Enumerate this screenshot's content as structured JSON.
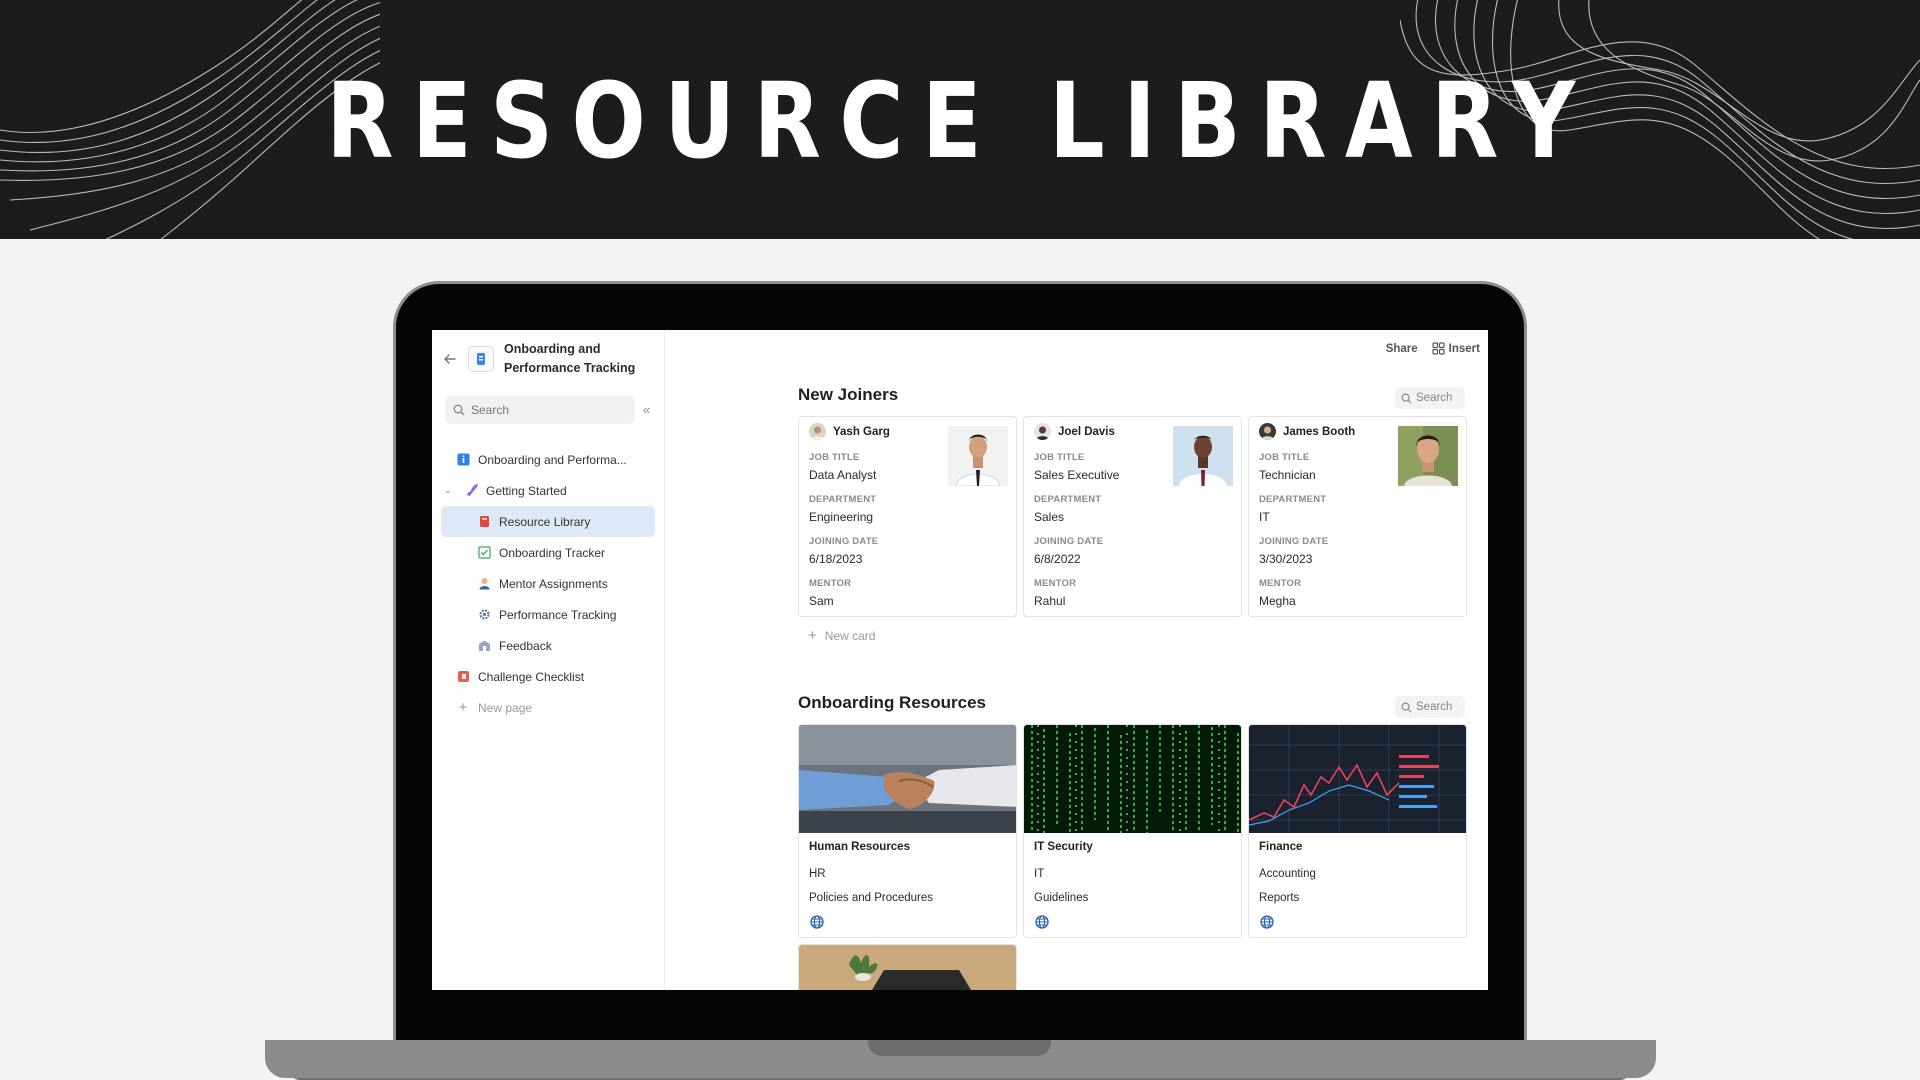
{
  "banner": {
    "title": "RESOURCE LIBRARY"
  },
  "sidebar": {
    "workspace_title": "Onboarding and Performance Tracking",
    "search_placeholder": "Search",
    "items": [
      {
        "label": "Onboarding and Performa...",
        "icon": "info-icon"
      },
      {
        "label": "Getting Started",
        "icon": "rocket-icon"
      },
      {
        "label": "Resource Library",
        "icon": "books-icon"
      },
      {
        "label": "Onboarding Tracker",
        "icon": "checkbox-icon"
      },
      {
        "label": "Mentor Assignments",
        "icon": "person-icon"
      },
      {
        "label": "Performance Tracking",
        "icon": "gear-icon"
      },
      {
        "label": "Feedback",
        "icon": "building-icon"
      },
      {
        "label": "Challenge Checklist",
        "icon": "flag-icon"
      }
    ],
    "new_page": "New page"
  },
  "topbar": {
    "share": "Share",
    "insert": "Insert"
  },
  "new_joiners": {
    "title": "New Joiners",
    "search": "Search",
    "field_labels": {
      "job_title": "JOB TITLE",
      "department": "DEPARTMENT",
      "joining_date": "JOINING DATE",
      "mentor": "MENTOR"
    },
    "cards": [
      {
        "name": "Yash Garg",
        "job_title": "Data Analyst",
        "department": "Engineering",
        "joining_date": "6/18/2023",
        "mentor": "Sam"
      },
      {
        "name": "Joel Davis",
        "job_title": "Sales Executive",
        "department": "Sales",
        "joining_date": "6/8/2022",
        "mentor": "Rahul"
      },
      {
        "name": "James Booth",
        "job_title": "Technician",
        "department": "IT",
        "joining_date": "3/30/2023",
        "mentor": "Megha"
      }
    ],
    "new_card": "New card"
  },
  "resources": {
    "title": "Onboarding Resources",
    "search": "Search",
    "cards": [
      {
        "title": "Human Resources",
        "line1": "HR",
        "line2": "Policies and Procedures"
      },
      {
        "title": "IT Security",
        "line1": "IT",
        "line2": "Guidelines"
      },
      {
        "title": "Finance",
        "line1": "Accounting",
        "line2": "Reports"
      }
    ]
  },
  "colors": {
    "banner_bg": "#1c1c1c",
    "active_nav": "#dde9f7",
    "globe": "#2a62b0"
  }
}
